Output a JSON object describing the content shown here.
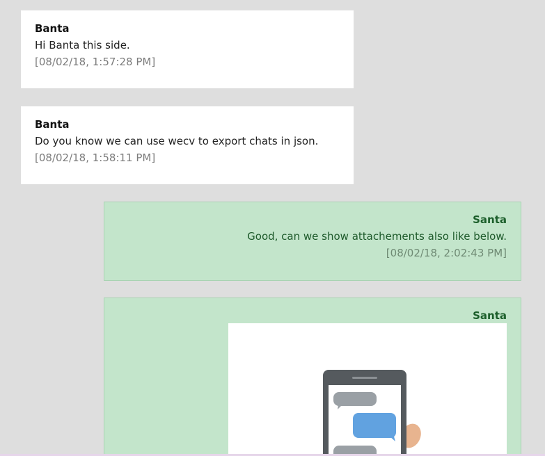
{
  "messages": [
    {
      "sender": "Banta",
      "text": "Hi Banta this side.",
      "time": "[08/02/18, 1:57:28 PM]",
      "direction": "incoming"
    },
    {
      "sender": "Banta",
      "text": "Do you know we can use wecv to export chats in json.",
      "time": "[08/02/18, 1:58:11 PM]",
      "direction": "incoming"
    },
    {
      "sender": "Santa",
      "text": "Good, can we show attachements also like below.",
      "time": "[08/02/18, 2:02:43 PM]",
      "direction": "outgoing"
    },
    {
      "sender": "Santa",
      "attachment": "phone-chat-illustration",
      "direction": "outgoing"
    }
  ],
  "colors": {
    "background": "#dedede",
    "incoming_bubble": "#ffffff",
    "outgoing_bubble": "#c3e5cb",
    "outgoing_sender": "#1b5e2a"
  }
}
